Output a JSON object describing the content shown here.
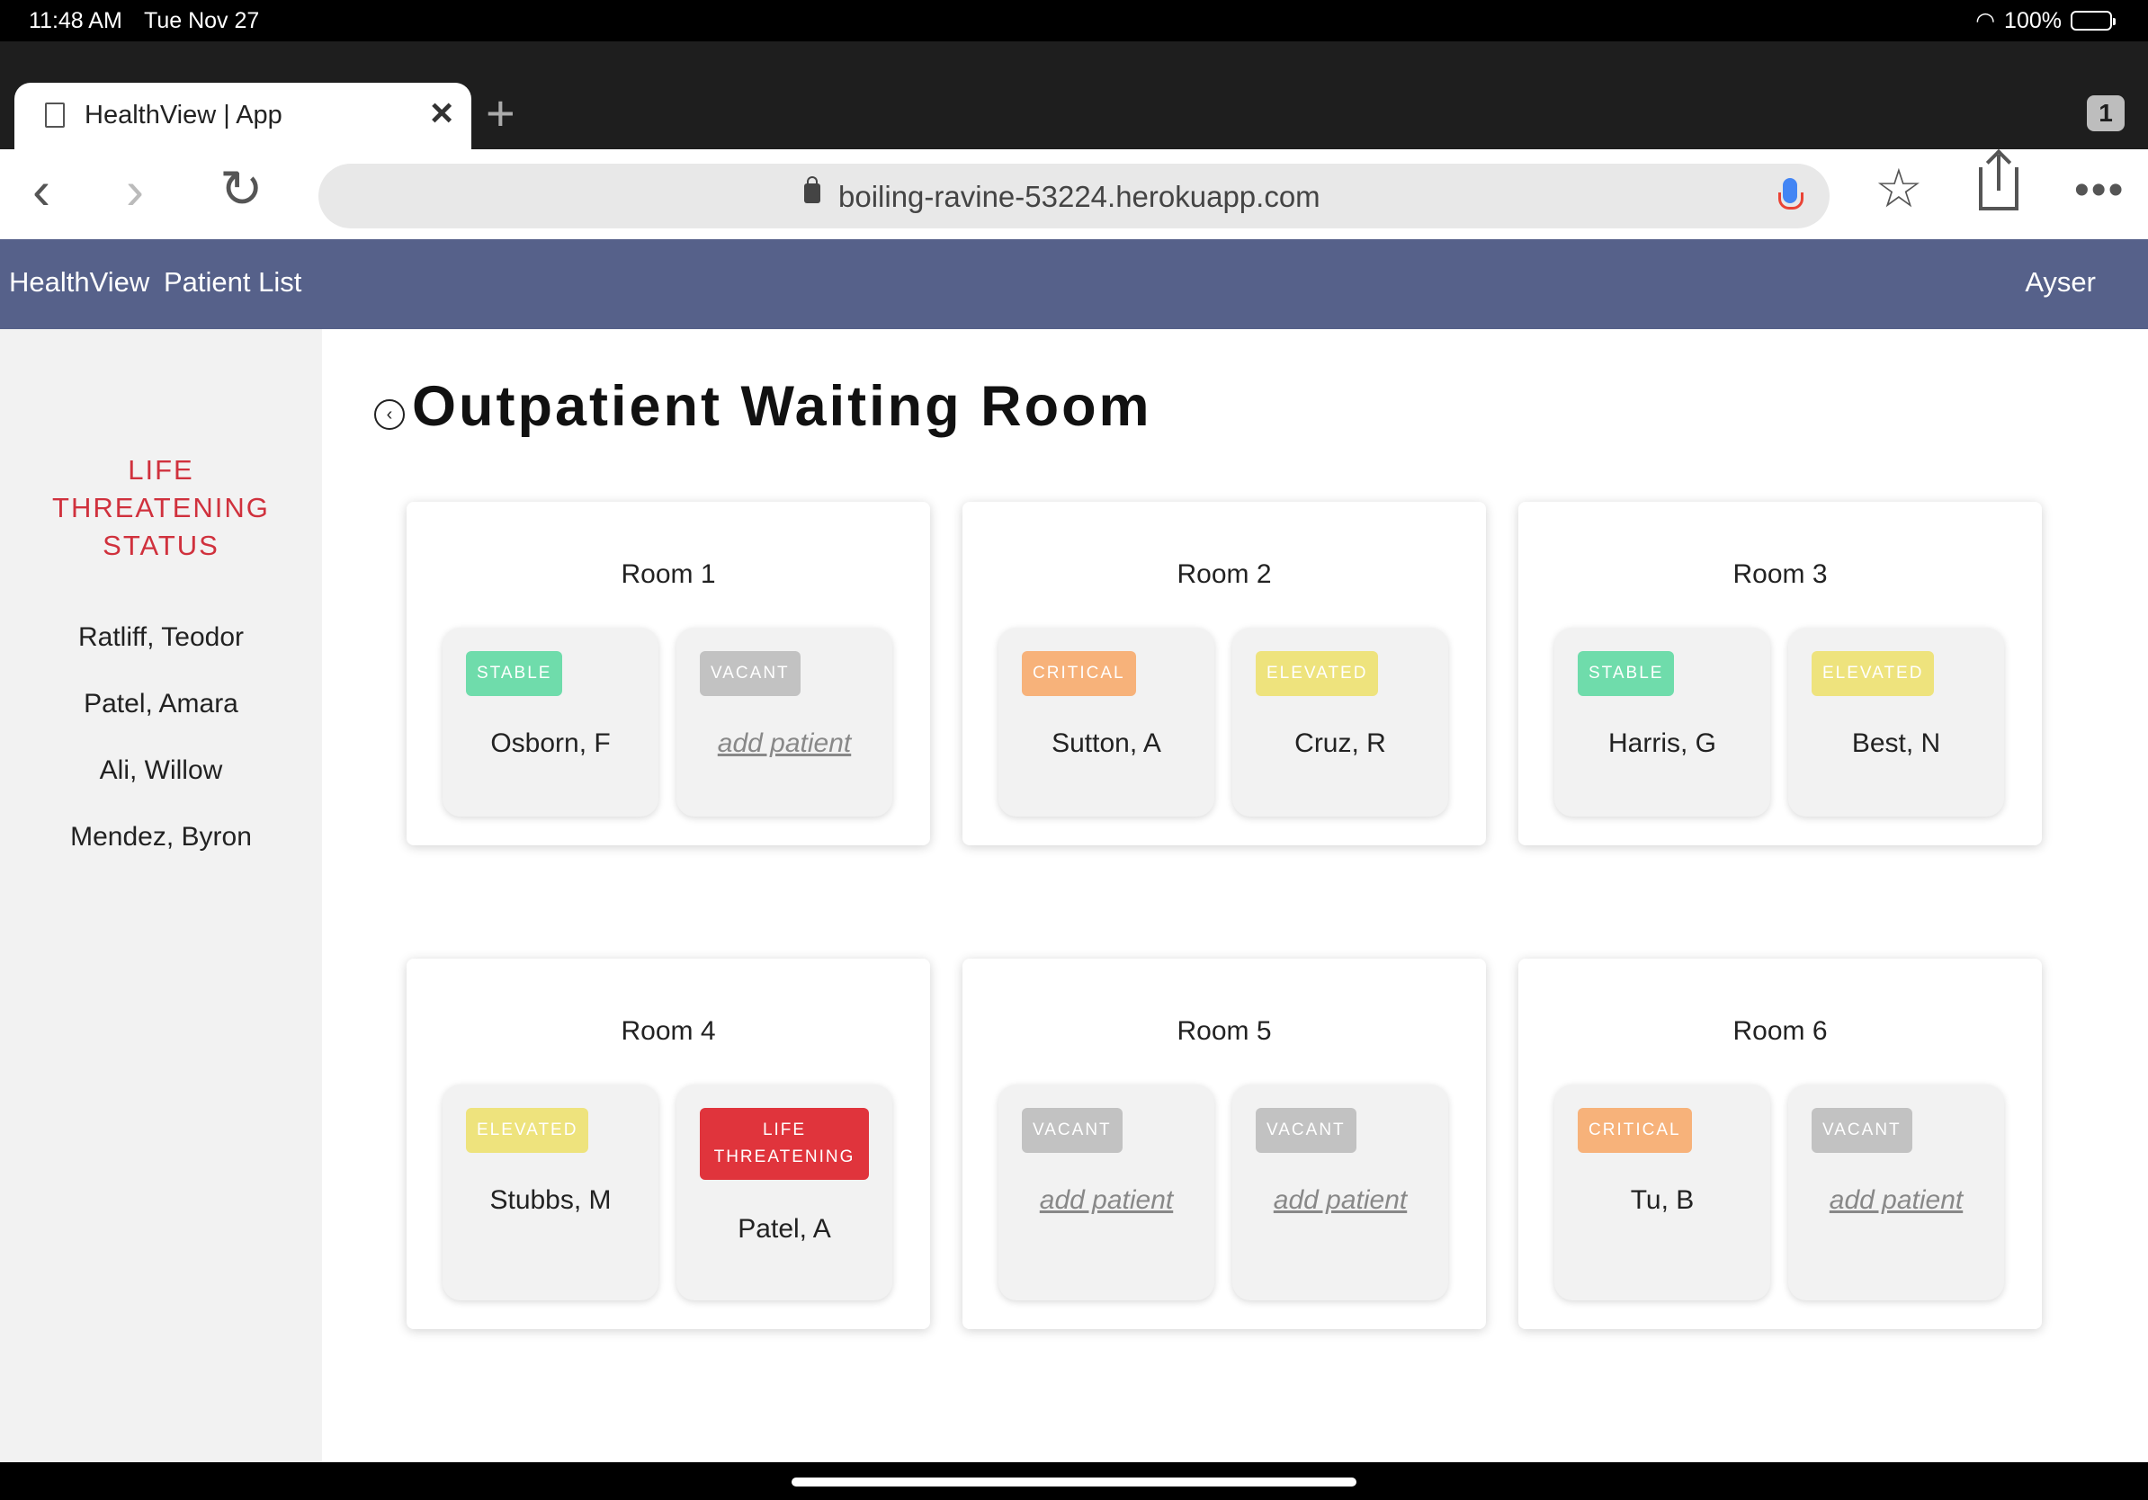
{
  "status_bar": {
    "time": "11:48 AM",
    "date": "Tue Nov 27",
    "battery": "100%"
  },
  "browser": {
    "tab_title": "HealthView | App",
    "tab_count": "1",
    "url": "boiling-ravine-53224.herokuapp.com"
  },
  "app_nav": {
    "brand": "HealthView",
    "patient_list": "Patient List",
    "user": "Ayser"
  },
  "sidebar": {
    "heading_lines": [
      "LIFE",
      "THREATENING",
      "STATUS"
    ],
    "patients": [
      "Ratliff, Teodor",
      "Patel, Amara",
      "Ali, Willow",
      "Mendez, Byron"
    ]
  },
  "page": {
    "title": "Outpatient Waiting Room",
    "back_glyph": "‹"
  },
  "status_colors": {
    "STABLE": "#6fdcab",
    "VACANT": "#c2c2c2",
    "CRITICAL": "#f7b27a",
    "ELEVATED": "#eee37d",
    "LIFE THREATENING": "#e0343c"
  },
  "rooms": [
    {
      "name": "Room 1",
      "beds": [
        {
          "status": "STABLE",
          "patient": "Osborn, F"
        },
        {
          "status": "VACANT",
          "patient": "add patient"
        }
      ]
    },
    {
      "name": "Room 2",
      "beds": [
        {
          "status": "CRITICAL",
          "patient": "Sutton, A"
        },
        {
          "status": "ELEVATED",
          "patient": "Cruz, R"
        }
      ]
    },
    {
      "name": "Room 3",
      "beds": [
        {
          "status": "STABLE",
          "patient": "Harris, G"
        },
        {
          "status": "ELEVATED",
          "patient": "Best, N"
        }
      ]
    },
    {
      "name": "Room 4",
      "beds": [
        {
          "status": "ELEVATED",
          "patient": "Stubbs, M"
        },
        {
          "status": "LIFE THREATENING",
          "status_lines": [
            "LIFE",
            "THREATENING"
          ],
          "patient": "Patel, A"
        }
      ]
    },
    {
      "name": "Room 5",
      "beds": [
        {
          "status": "VACANT",
          "patient": "add patient"
        },
        {
          "status": "VACANT",
          "patient": "add patient"
        }
      ]
    },
    {
      "name": "Room 6",
      "beds": [
        {
          "status": "CRITICAL",
          "patient": "Tu, B"
        },
        {
          "status": "VACANT",
          "patient": "add patient"
        }
      ]
    }
  ]
}
